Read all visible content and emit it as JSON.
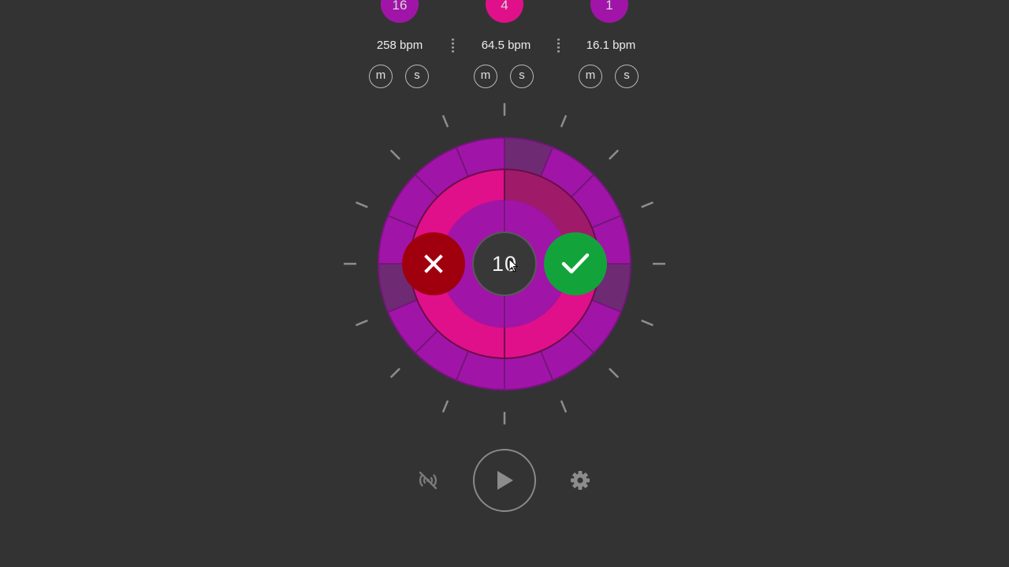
{
  "colors": {
    "background": "#333333",
    "magenta": "#e0108a",
    "purple": "#a015a8",
    "cancel_red": "#a0000e",
    "confirm_green": "#12a43a"
  },
  "layers": [
    {
      "value": "16",
      "bpm": "258 bpm",
      "color": "#a015a8",
      "mute_label": "m",
      "solo_label": "s"
    },
    {
      "value": "4",
      "bpm": "64.5 bpm",
      "color": "#e0108a",
      "mute_label": "m",
      "solo_label": "s"
    },
    {
      "value": "1",
      "bpm": "16.1 bpm",
      "color": "#a015a8",
      "mute_label": "m",
      "solo_label": "s"
    }
  ],
  "dial": {
    "input_value": "10",
    "outer_ring_beats": 16,
    "middle_ring_beats": 4,
    "inner_ring_beats": 1,
    "cancel_icon": "close-icon",
    "confirm_icon": "checkmark-icon"
  },
  "controls": {
    "sync_icon": "broadcast-off-icon",
    "play_icon": "play-icon",
    "settings_icon": "gear-icon"
  }
}
